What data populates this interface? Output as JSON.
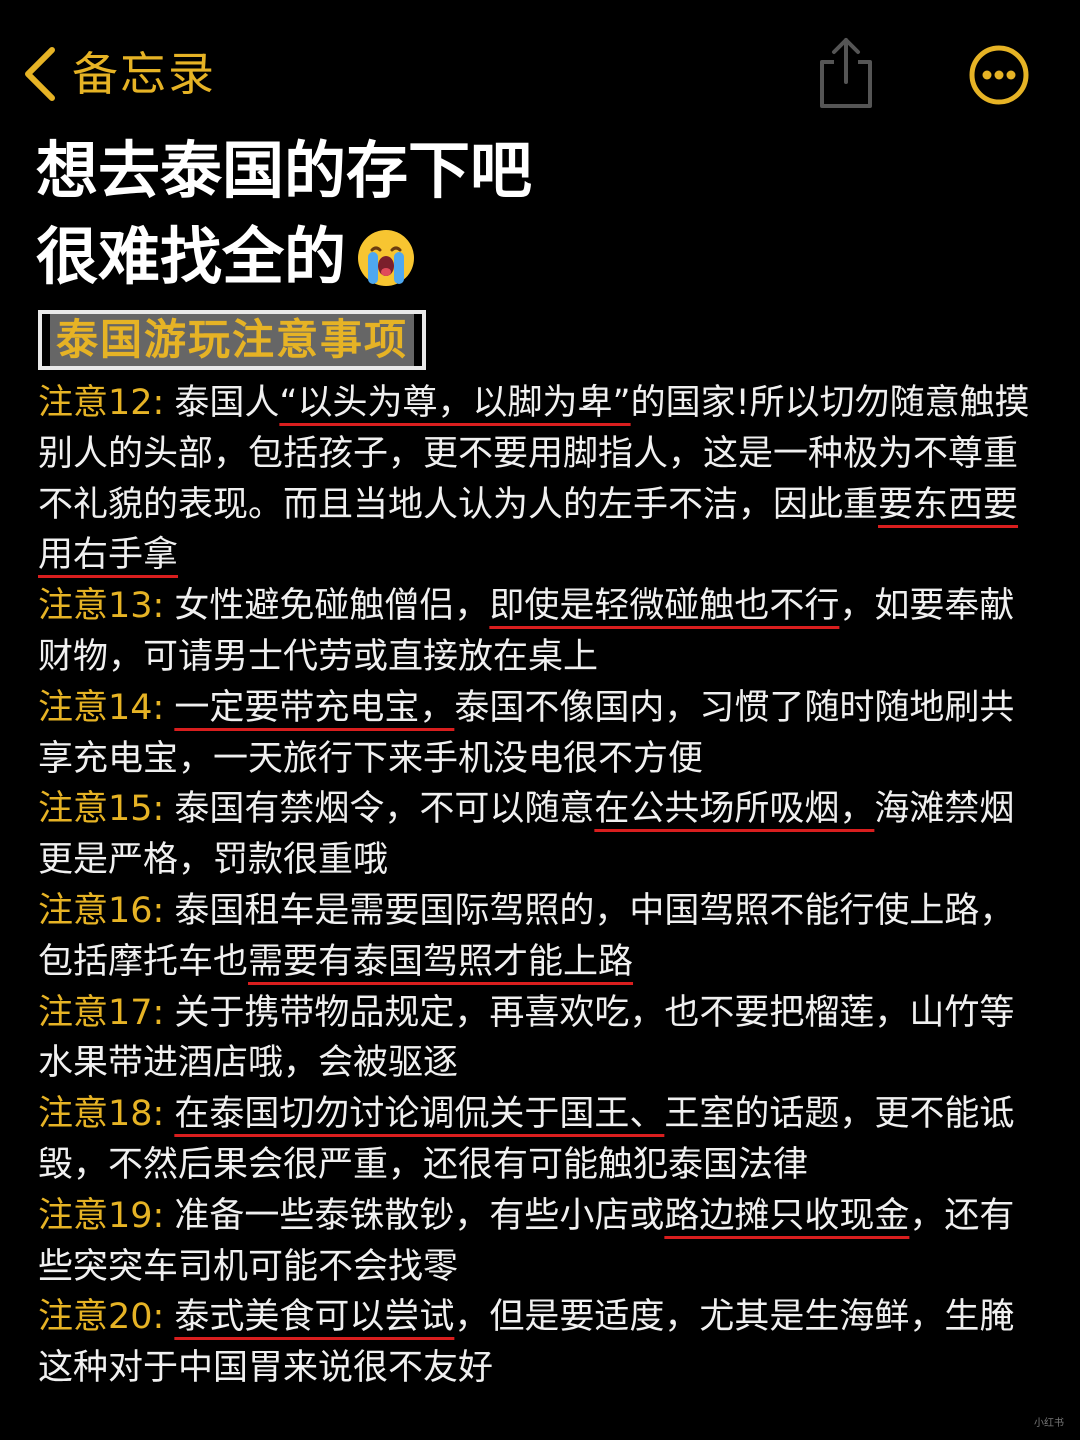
{
  "nav": {
    "back_label": "备忘录",
    "accent_color": "#E6B325",
    "icons": {
      "back": "chevron-left-icon",
      "share": "share-icon",
      "more": "more-icon"
    }
  },
  "title": {
    "line1": "想去泰国的存下吧",
    "line2": "很难找全的",
    "emoji": "loudly-crying-face-icon"
  },
  "section_heading": "泰国游玩注意事项",
  "notes": [
    {
      "label": "注意12:",
      "segments": [
        {
          "text": "泰国人",
          "u": false
        },
        {
          "text": "“以头为尊，以脚为卑”",
          "u": true
        },
        {
          "text": "的国家!所以切勿随意触摸别人的头部，包括孩子，更不要用脚指人，这是一种极为不尊重不礼貌的表现。而且当地人认为人的左手不洁，因此重",
          "u": false
        },
        {
          "text": "要东西要用右手拿",
          "u": true
        }
      ]
    },
    {
      "label": "注意13:",
      "segments": [
        {
          "text": "女性避免碰触僧侣，",
          "u": false
        },
        {
          "text": "即使是轻微碰触也不行",
          "u": true
        },
        {
          "text": "，如要奉献财物，可请男士代劳或直接放在桌上",
          "u": false
        }
      ]
    },
    {
      "label": "注意14:",
      "segments": [
        {
          "text": "一定要带充电宝，",
          "u": true
        },
        {
          "text": "泰国不像国内，习惯了随时随地刷共享充电宝，一天旅行下来手机没电很不方便",
          "u": false
        }
      ]
    },
    {
      "label": "注意15:",
      "segments": [
        {
          "text": "泰国有禁烟令，不可以随意",
          "u": false
        },
        {
          "text": "在公共场所吸烟，",
          "u": true
        },
        {
          "text": "海滩禁烟更是严格，罚款很重哦",
          "u": false
        }
      ]
    },
    {
      "label": "注意16:",
      "segments": [
        {
          "text": "泰国租车是需要国际驾照的，中国驾照不能行使上路，包括摩托车也",
          "u": false
        },
        {
          "text": "需要有泰国驾照才能上路",
          "u": true
        }
      ]
    },
    {
      "label": "注意17:",
      "segments": [
        {
          "text": "关于携带物品规定，再喜欢吃，也不要把榴莲，山竹等水果带进酒店哦，会被驱逐",
          "u": false
        }
      ]
    },
    {
      "label": "注意18:",
      "segments": [
        {
          "text": "在泰国切勿讨论调侃关于国王、",
          "u": true
        },
        {
          "text": "王室的话题，更不能诋毁，不然后果会很严重，还很有可能触犯泰国法律",
          "u": false
        }
      ]
    },
    {
      "label": "注意19:",
      "segments": [
        {
          "text": "准备一些泰铢散钞，有些小店或",
          "u": false
        },
        {
          "text": "路边摊只收现金",
          "u": true
        },
        {
          "text": "，还有些突突车司机可能不会找零",
          "u": false
        }
      ]
    },
    {
      "label": "注意20:",
      "segments": [
        {
          "text": "泰式美食可以尝试",
          "u": true
        },
        {
          "text": "，但是要适度，尤其是生海鲜，生腌这种对于中国胃来说很不友好",
          "u": false
        }
      ]
    }
  ],
  "underline_color": "#D91E1E",
  "watermark": "小红书"
}
